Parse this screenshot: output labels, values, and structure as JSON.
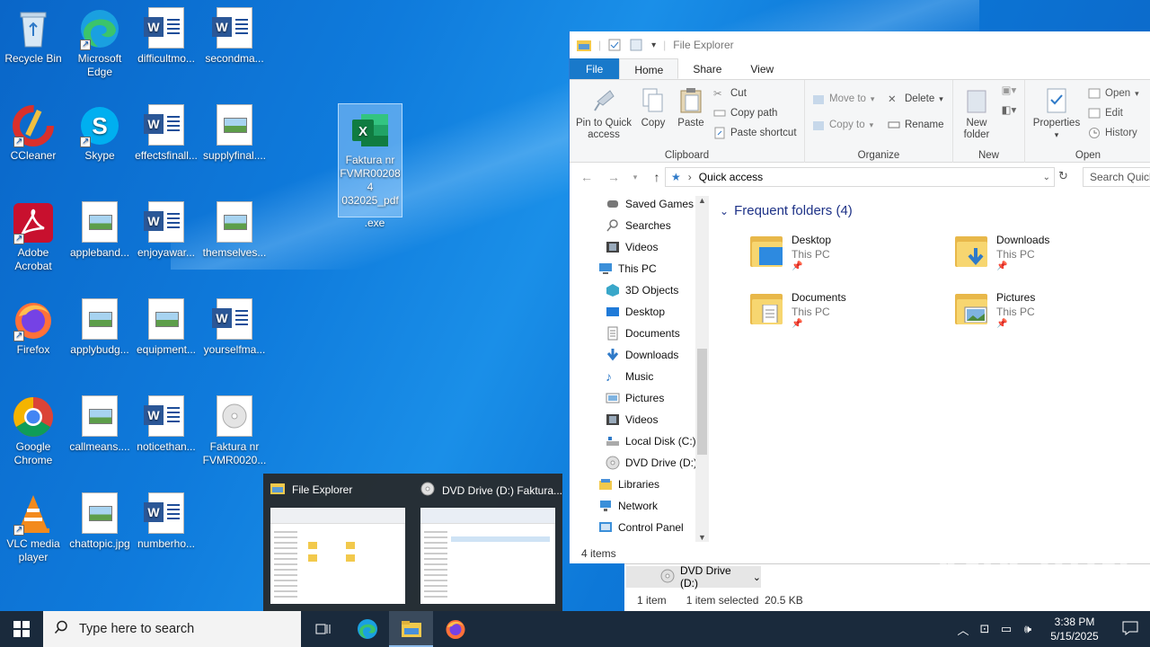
{
  "desktop": {
    "icons": [
      {
        "label": "Recycle Bin"
      },
      {
        "label": "Microsoft Edge"
      },
      {
        "label": "difficultmo..."
      },
      {
        "label": "secondma..."
      },
      {
        "label": "CCleaner"
      },
      {
        "label": "Skype"
      },
      {
        "label": "effectsfinall..."
      },
      {
        "label": "supplyfinal...."
      },
      {
        "label": "Adobe Acrobat"
      },
      {
        "label": "appleband..."
      },
      {
        "label": "enjoyawar..."
      },
      {
        "label": "themselves..."
      },
      {
        "label": "Firefox"
      },
      {
        "label": "applybudg..."
      },
      {
        "label": "equipment..."
      },
      {
        "label": "yourselfma..."
      },
      {
        "label": "Google Chrome"
      },
      {
        "label": "callmeans...."
      },
      {
        "label": "noticethan..."
      },
      {
        "label": "Faktura nr FVMR0020..."
      },
      {
        "label": "VLC media player"
      },
      {
        "label": "chattopic.jpg"
      },
      {
        "label": "numberho..."
      },
      {
        "label": "Faktura nr FVMR002084 032025_pdf",
        "label2": ".exe"
      }
    ]
  },
  "explorer": {
    "title": "File Explorer",
    "tabs": [
      "File",
      "Home",
      "Share",
      "View"
    ],
    "ribbon": {
      "clipboard": {
        "pin": "Pin to Quick access",
        "copy": "Copy",
        "paste": "Paste",
        "cut": "Cut",
        "copy_path": "Copy path",
        "paste_shortcut": "Paste shortcut",
        "label": "Clipboard"
      },
      "organize": {
        "move_to": "Move to",
        "copy_to": "Copy to",
        "delete": "Delete",
        "rename": "Rename",
        "label": "Organize"
      },
      "new": {
        "new_folder": "New folder",
        "label": "New"
      },
      "open": {
        "properties": "Properties",
        "open": "Open",
        "edit": "Edit",
        "history": "History",
        "label": "Open"
      }
    },
    "address": "Quick access",
    "search_placeholder": "Search Quick access",
    "nav": [
      "Saved Games",
      "Searches",
      "Videos",
      "This PC",
      "3D Objects",
      "Desktop",
      "Documents",
      "Downloads",
      "Music",
      "Pictures",
      "Videos",
      "Local Disk (C:)",
      "DVD Drive (D:)",
      "Libraries",
      "Network",
      "Control Panel"
    ],
    "section_title": "Frequent folders (4)",
    "folders": [
      {
        "name": "Desktop",
        "location": "This PC"
      },
      {
        "name": "Downloads",
        "location": "This PC"
      },
      {
        "name": "Documents",
        "location": "This PC"
      },
      {
        "name": "Pictures",
        "location": "This PC"
      }
    ],
    "status": "4 items"
  },
  "window2": {
    "tab": "DVD Drive (D:)",
    "items": "1 item",
    "selected": "1 item selected  20.5 KB"
  },
  "thumbnails": [
    {
      "title": "File Explorer"
    },
    {
      "title": "DVD Drive (D:) Faktura..."
    }
  ],
  "taskbar": {
    "search_placeholder": "Type here to search",
    "time": "3:38 PM",
    "date": "5/15/2025"
  },
  "watermark": "ANY RUN",
  "colors": {
    "accent": "#1979ca",
    "taskbar": "#1a2a3c",
    "folder": "#f7d670"
  }
}
